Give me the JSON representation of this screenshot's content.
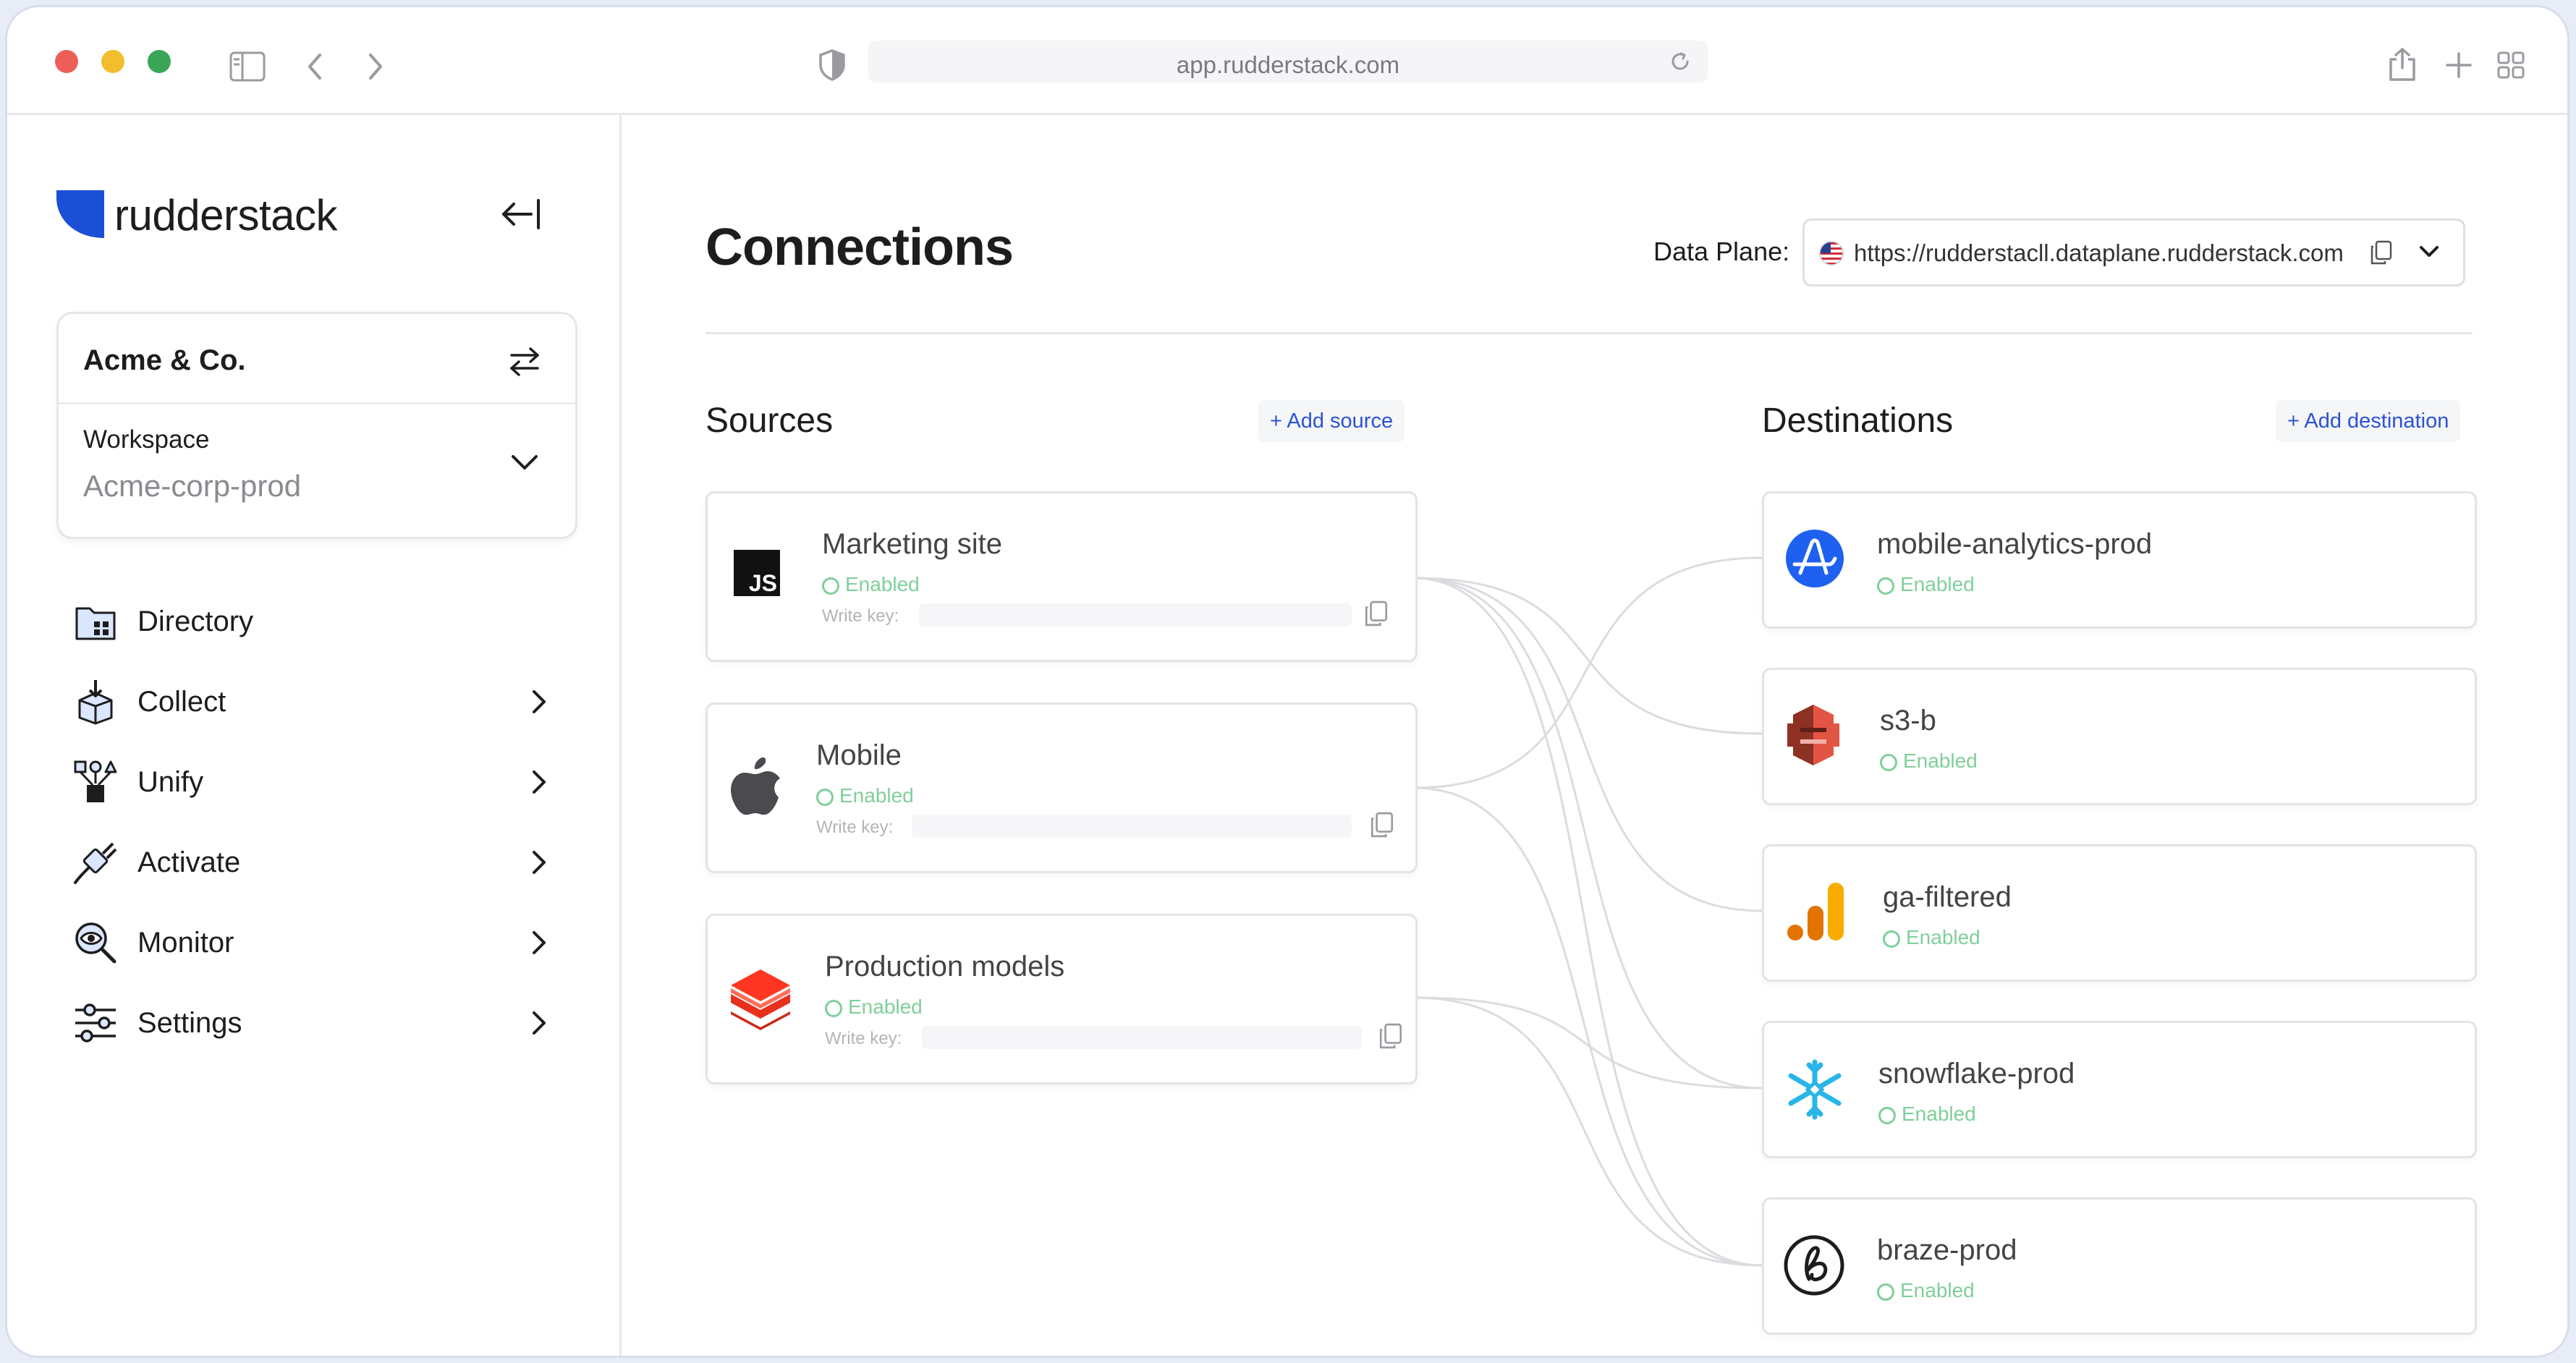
{
  "browser": {
    "url": "app.rudderstack.com"
  },
  "sidebar": {
    "brand": "rudderstack",
    "organization": "Acme & Co.",
    "workspace_label": "Workspace",
    "workspace_name": "Acme-corp-prod",
    "nav": [
      {
        "label": "Directory",
        "icon": "directory-icon",
        "has_chevron": false
      },
      {
        "label": "Collect",
        "icon": "collect-icon",
        "has_chevron": true
      },
      {
        "label": "Unify",
        "icon": "unify-icon",
        "has_chevron": true
      },
      {
        "label": "Activate",
        "icon": "activate-icon",
        "has_chevron": true
      },
      {
        "label": "Monitor",
        "icon": "monitor-icon",
        "has_chevron": true
      },
      {
        "label": "Settings",
        "icon": "settings-icon",
        "has_chevron": true
      }
    ]
  },
  "main": {
    "title": "Connections",
    "data_plane_label": "Data Plane:",
    "data_plane_url": "https://rudderstacll.dataplane.rudderstack.com",
    "sources_title": "Sources",
    "add_source_label": "+ Add source",
    "destinations_title": "Destinations",
    "add_destination_label": "+ Add destination",
    "sources": [
      {
        "name": "Marketing site",
        "status": "Enabled",
        "write_key_label": "Write key:",
        "icon": "javascript-icon"
      },
      {
        "name": "Mobile",
        "status": "Enabled",
        "write_key_label": "Write key:",
        "icon": "apple-icon"
      },
      {
        "name": "Production models",
        "status": "Enabled",
        "write_key_label": "Write key:",
        "icon": "databricks-icon"
      }
    ],
    "destinations": [
      {
        "name": "mobile-analytics-prod",
        "status": "Enabled",
        "icon": "amplitude-icon"
      },
      {
        "name": "s3-b",
        "status": "Enabled",
        "icon": "aws-s3-icon"
      },
      {
        "name": "ga-filtered",
        "status": "Enabled",
        "icon": "google-analytics-icon"
      },
      {
        "name": "snowflake-prod",
        "status": "Enabled",
        "icon": "snowflake-icon"
      },
      {
        "name": "braze-prod",
        "status": "Enabled",
        "icon": "braze-icon"
      }
    ]
  },
  "colors": {
    "accent": "#2b52d6",
    "enabled": "#7fcf9a",
    "brand": "#1a4fd6"
  }
}
